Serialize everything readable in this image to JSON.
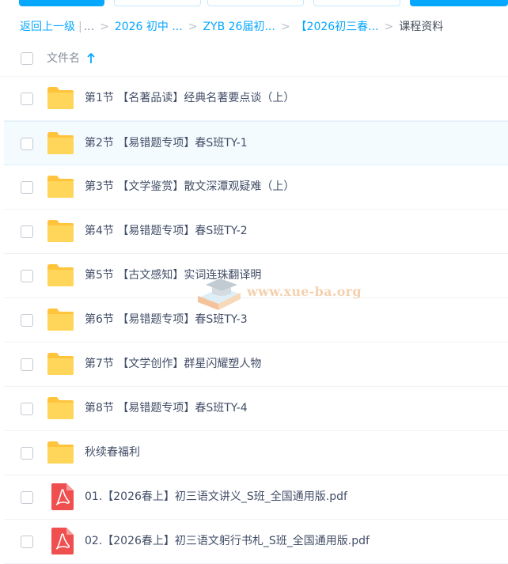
{
  "breadcrumb": {
    "back": "返回上一级",
    "bar_sep": "|",
    "ellipsis": "...",
    "sep": ">",
    "items": [
      "2026 初中 ...",
      "ZYB 26届初...",
      "【2026初三春...",
      "课程资料"
    ]
  },
  "header": {
    "name_col": "文件名",
    "sort": "ascending"
  },
  "files": [
    {
      "name": "第1节 【名著品读】经典名著要点谈（上）",
      "type": "folder"
    },
    {
      "name": "第2节 【易错题专项】春S班TY-1",
      "type": "folder",
      "hover": true
    },
    {
      "name": "第3节 【文学鉴赏】散文深潭观疑难（上）",
      "type": "folder"
    },
    {
      "name": "第4节 【易错题专项】春S班TY-2",
      "type": "folder"
    },
    {
      "name": "第5节 【古文感知】实词连珠翻译明",
      "type": "folder"
    },
    {
      "name": "第6节 【易错题专项】春S班TY-3",
      "type": "folder"
    },
    {
      "name": "第7节 【文学创作】群星闪耀塑人物",
      "type": "folder"
    },
    {
      "name": "第8节 【易错题专项】春S班TY-4",
      "type": "folder"
    },
    {
      "name": "秋续春福利",
      "type": "folder"
    },
    {
      "name": "01.【2026春上】初三语文讲义_S班_全国通用版.pdf",
      "type": "pdf"
    },
    {
      "name": "02.【2026春上】初三语文躬行书札_S班_全国通用版.pdf",
      "type": "pdf"
    }
  ],
  "icons": {
    "folder": "folder-icon",
    "pdf": "pdf-icon",
    "sort": "arrow-up-icon"
  },
  "colors": {
    "accent": "#06a7ff",
    "folder": "#ffd659",
    "pdf": "#ef4f4f",
    "text": "#424e67",
    "muted": "#878c9c",
    "row_hover": "#f4fbff"
  },
  "watermark": {
    "text": "www.xue-ba.org"
  }
}
